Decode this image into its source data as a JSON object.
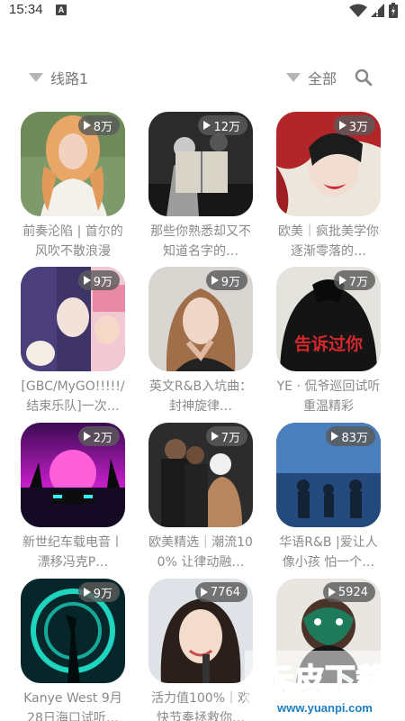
{
  "status_bar": {
    "time": "15:34",
    "notification_icon": "A"
  },
  "filters": {
    "route_label": "线路1",
    "category_label": "全部"
  },
  "playlists": [
    {
      "title": "前奏沦陷 | 首尔的风吹不散浪漫",
      "plays": "8万"
    },
    {
      "title": "那些你熟悉却又不知道名字的…",
      "plays": "12万"
    },
    {
      "title": "欧美｜疯批美学你逐渐零落的…",
      "plays": "3万"
    },
    {
      "title": "[GBC/MyGO!!!!!/结束乐队]一次…",
      "plays": "9万"
    },
    {
      "title": "英文R&B入坑曲：封神旋律…",
      "plays": "9万"
    },
    {
      "title": "YE · 侃爷巡回试听 重温精彩",
      "plays": "7万"
    },
    {
      "title": "新世纪车载电音丨漂移冯克P…",
      "plays": "2万"
    },
    {
      "title": "欧美精选｜潮流100% 让律动融…",
      "plays": "7万"
    },
    {
      "title": "华语R&B |爱让人像小孩 怕一个…",
      "plays": "83万"
    },
    {
      "title": "Kanye West 9月28日海口试听…",
      "plays": "9万"
    },
    {
      "title": "活力值100%｜欢快节奏拯救你…",
      "plays": "7764"
    },
    {
      "title": "…",
      "plays": "5924"
    }
  ],
  "cover_text": {
    "card6": "告诉过你"
  },
  "watermark": {
    "brand": "元皮下载",
    "url": "www.yuanpi.com"
  }
}
